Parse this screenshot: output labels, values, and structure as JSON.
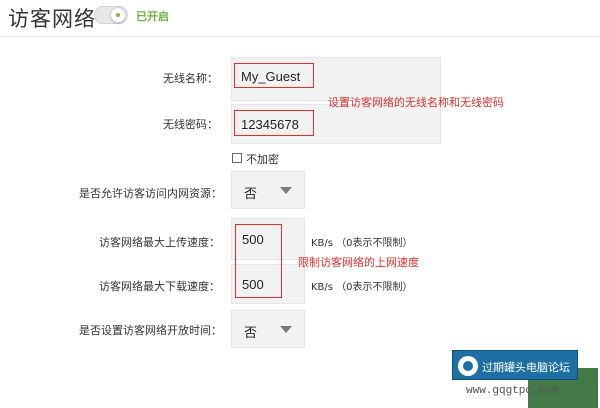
{
  "header": {
    "title": "访客网络",
    "status": "已开启",
    "toggle_on": true
  },
  "form": {
    "ssid_label": "无线名称：",
    "ssid_value": "My_Guest",
    "password_label": "无线密码：",
    "password_value": "12345678",
    "no_encrypt_label": "不加密",
    "no_encrypt_checked": false,
    "intranet_label": "是否允许访客访问内网资源：",
    "intranet_value": "否",
    "upload_label": "访客网络最大上传速度：",
    "upload_value": "500",
    "upload_unit": "KB/s （0表示不限制）",
    "download_label": "访客网络最大下载速度：",
    "download_value": "500",
    "download_unit": "KB/s （0表示不限制）",
    "schedule_label": "是否设置访客网络开放时间：",
    "schedule_value": "否"
  },
  "annotations": {
    "ssid_note": "设置访客网络的无线名称和无线密码",
    "speed_note": "限制访客网络的上网速度"
  },
  "watermark": {
    "name": "过期罐头电脑论坛",
    "url": "www.gqgtpc.com"
  },
  "colors": {
    "accent_green": "#6db33f",
    "annotation_red": "#e0302a",
    "field_bg": "#f2f2f2"
  }
}
